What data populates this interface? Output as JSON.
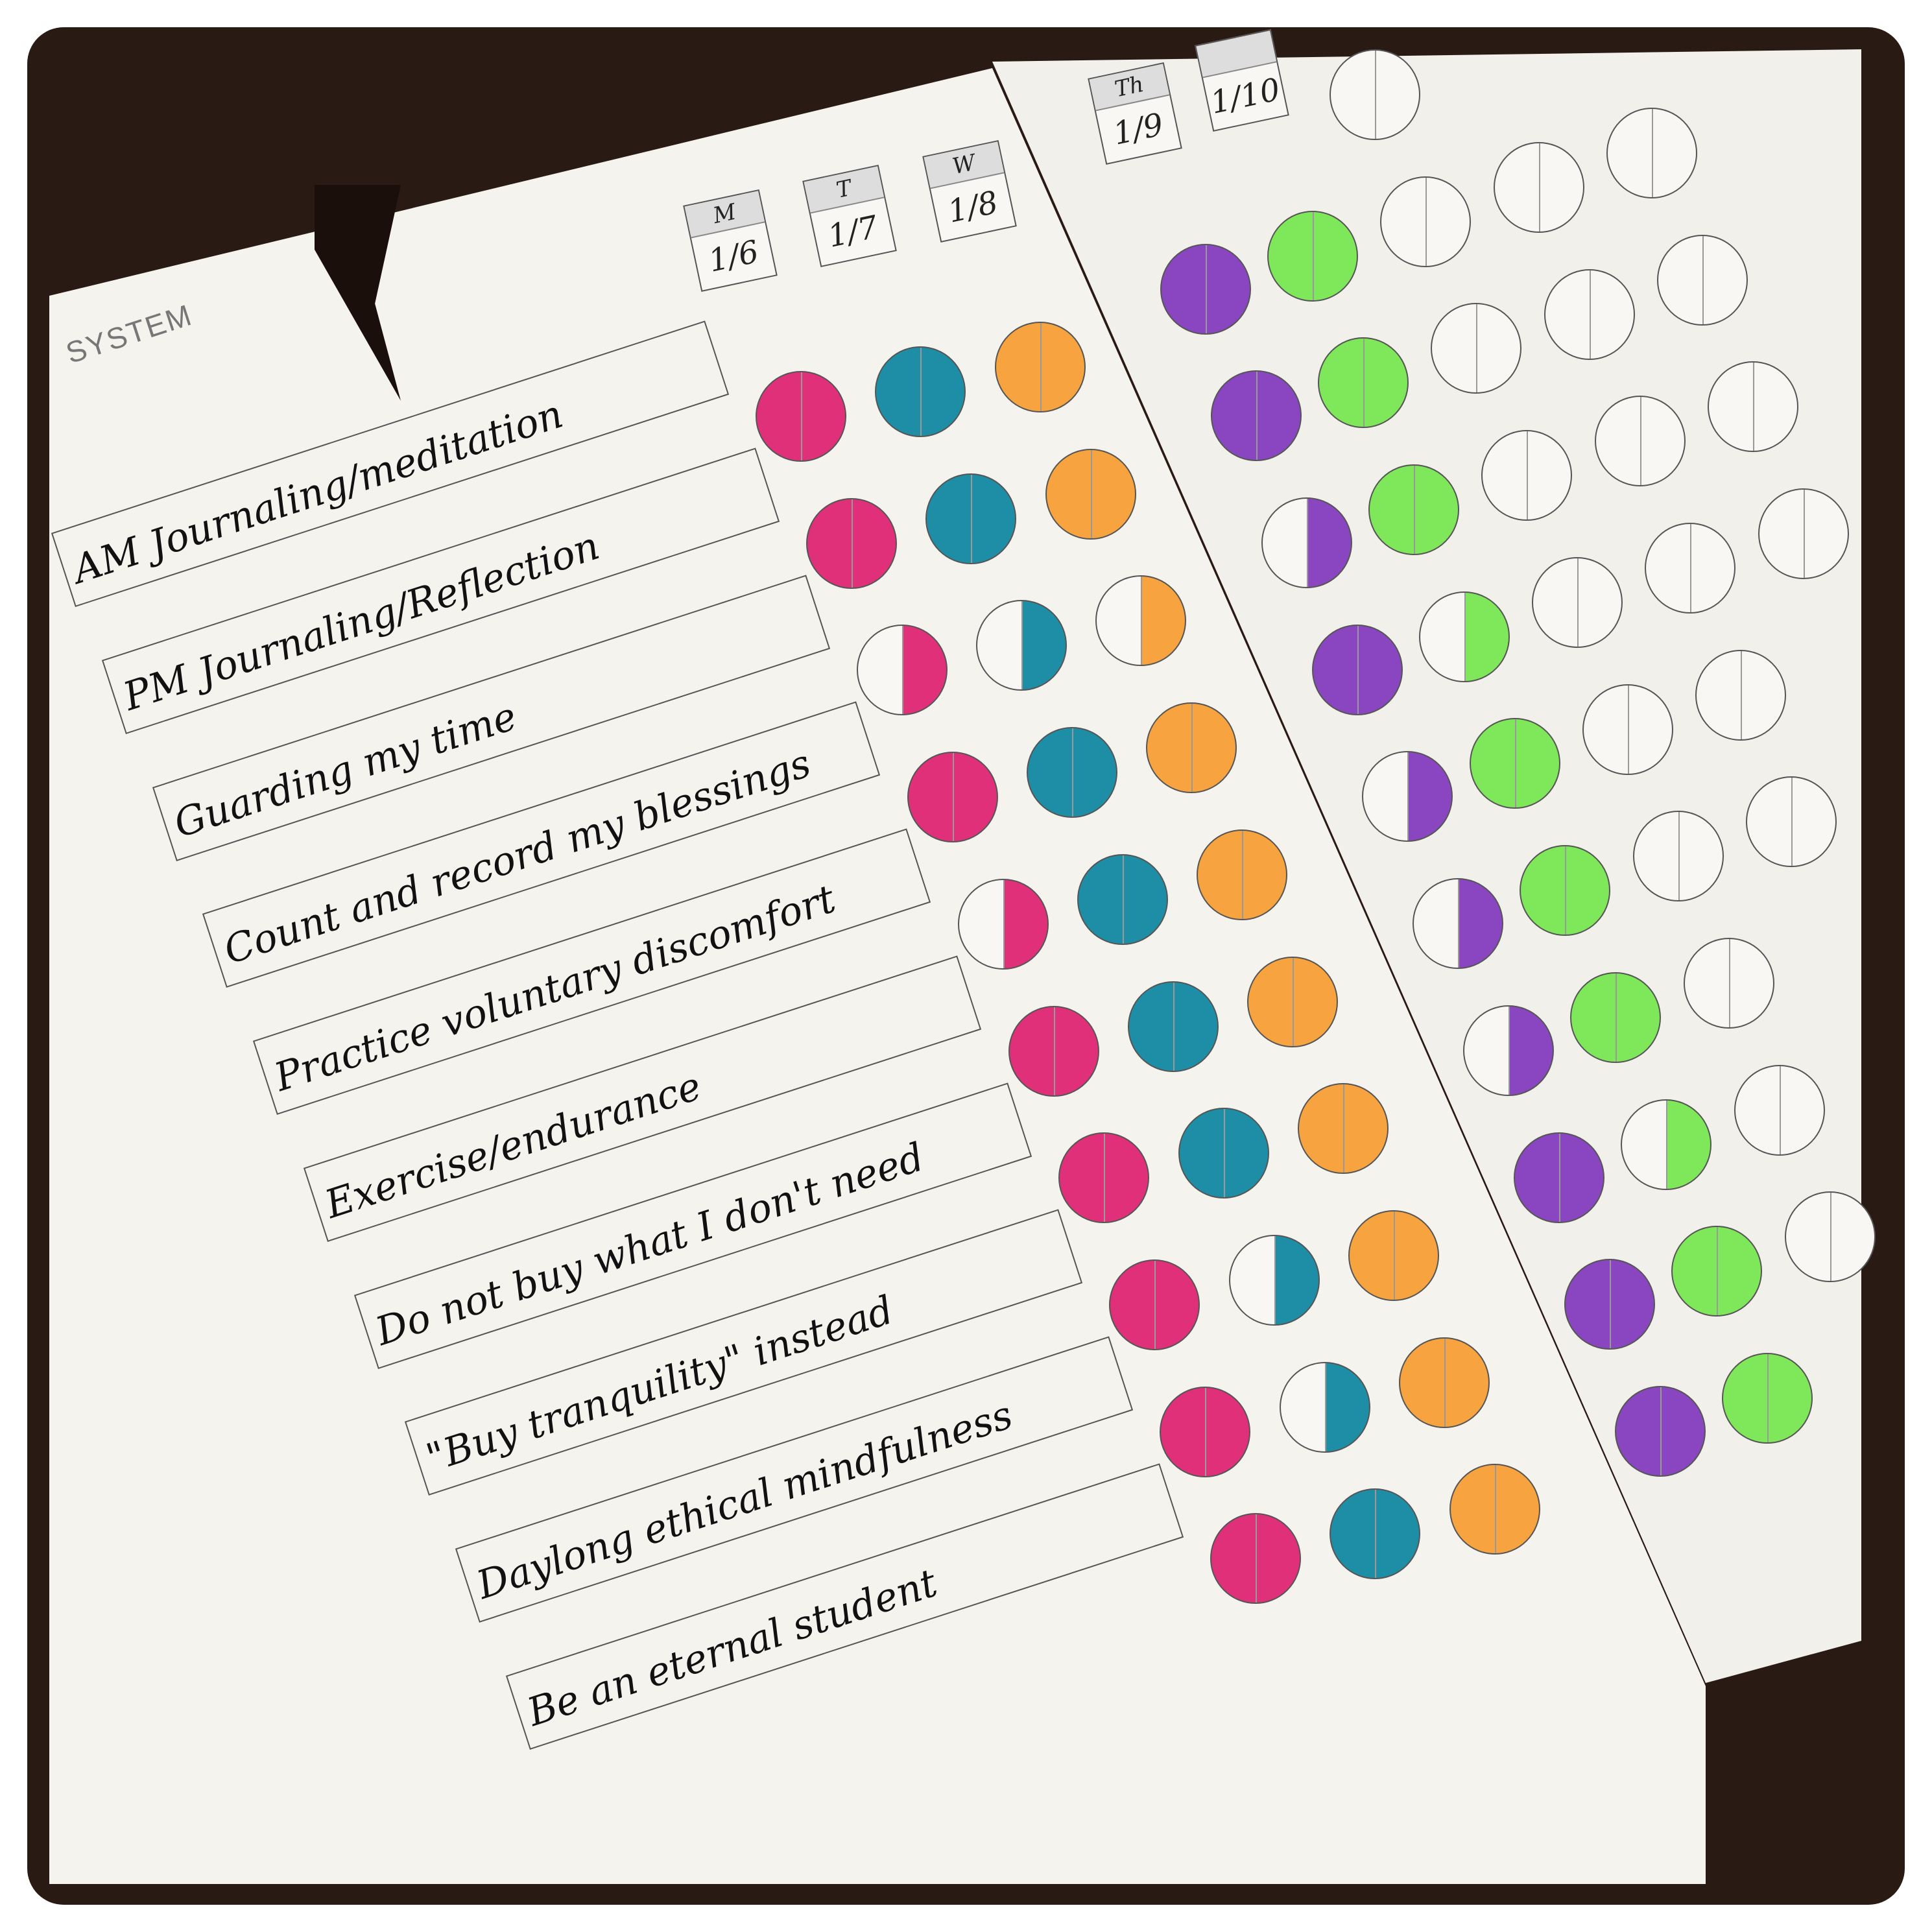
{
  "header_text": "SYSTEM",
  "habits": [
    "AM Journaling/meditation",
    "PM Journaling/Reflection",
    "Guarding my time",
    "Count and record my blessings",
    "Practice voluntary discomfort",
    "Exercise/endurance",
    "Do not buy what I don't need",
    "\"Buy tranquility\" instead",
    "Daylong ethical mindfulness",
    "Be an eternal student"
  ],
  "days": [
    {
      "day": "M",
      "date": "1/6",
      "color": "#e0307a",
      "states": [
        "full",
        "full",
        "half",
        "full",
        "half",
        "full",
        "full",
        "full",
        "full",
        "full"
      ]
    },
    {
      "day": "T",
      "date": "1/7",
      "color": "#1e8ea6",
      "states": [
        "full",
        "full",
        "half",
        "full",
        "full",
        "full",
        "full",
        "half",
        "half",
        "full"
      ]
    },
    {
      "day": "W",
      "date": "1/8",
      "color": "#f7a33f",
      "states": [
        "full",
        "full",
        "half",
        "full",
        "full",
        "full",
        "full",
        "full",
        "full",
        "full"
      ]
    },
    {
      "day": "Th",
      "date": "1/9",
      "color": "#8a45c0",
      "states": [
        "full",
        "full",
        "half",
        "full",
        "half",
        "half",
        "half",
        "full",
        "full",
        "full"
      ]
    },
    {
      "day": "",
      "date": "1/10",
      "color": "#7ee85a",
      "states": [
        "full",
        "full",
        "full",
        "half",
        "full",
        "full",
        "full",
        "half",
        "full",
        "full"
      ]
    }
  ],
  "colors": {
    "background": "#2a1a14",
    "page": "#f5f3ee"
  }
}
